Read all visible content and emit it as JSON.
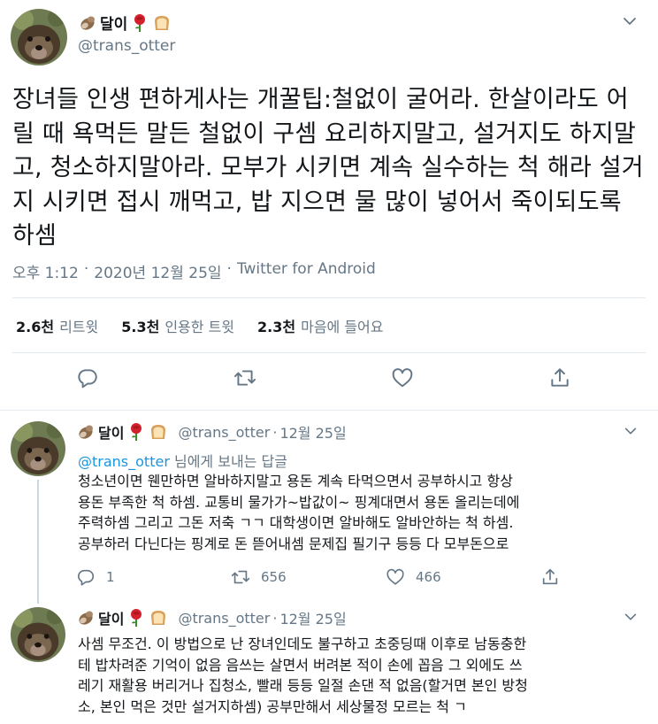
{
  "colors": {
    "accent": "#1b95e0",
    "muted": "#657786",
    "text": "#14171a",
    "icon": "#1b95e0"
  },
  "tweet": {
    "display_name": "달이",
    "handle": "@trans_otter",
    "text": "장녀들 인생 편하게사는 개꿀팁:철없이 굴어라. 한살이라도 어릴 때 욕먹든 말든 철없이 구셈 요리하지말고, 설거지도 하지말고, 청소하지말아라. 모부가 시키면 계속 실수하는 척 해라 설거지 시키면 접시 깨먹고, 밥 지으면 물 많이 넣어서 죽이되도록 하셈",
    "time": "오후 1:12",
    "date": "2020년 12월 25일",
    "source": "Twitter for Android",
    "dot": "·",
    "stats": [
      {
        "count": "2.6천",
        "label": "리트윗"
      },
      {
        "count": "5.3천",
        "label": "인용한 트윗"
      },
      {
        "count": "2.3천",
        "label": "마음에 들어요"
      }
    ],
    "actions": [
      "reply-icon",
      "retweet-icon",
      "like-icon",
      "share-icon"
    ]
  },
  "replies": [
    {
      "display_name": "달이",
      "handle": "@trans_otter",
      "date": "12월 25일",
      "dot": "·",
      "replying_prefix": "@trans_otter",
      "replying_suffix": " 님에게 보내는 답글",
      "lines": [
        "청소년이면 웬만하면 알바하지말고 용돈 계속 타먹으면서 공부하시고 항상",
        "용돈 부족한 척 하셈. 교통비 물가가~밥값이~ 핑계대면서 용돈 올리는데에",
        "주력하셈 그리고 그돈 저축 ㄱㄱ 대학생이면 알바해도 알바안하는 척 하셈.",
        "공부하러 다닌다는 핑계로 돈 뜯어내셈 문제집 필기구 등등 다 모부돈으로"
      ],
      "reply_count": "1",
      "retweet_count": "656",
      "like_count": "466"
    },
    {
      "display_name": "달이",
      "handle": "@trans_otter",
      "date": "12월 25일",
      "dot": "·",
      "lines": [
        "사셈 무조건. 이 방법으로 난 장녀인데도 불구하고 초중딩때 이후로 남동충한",
        "테 밥차려준 기억이 없음 음쓰는 살면서 버려본 적이 손에 꼽음 그 외에도 쓰",
        "레기 재활용 버리거나 집청소, 빨래 등등 일절 손댄 적 없음(할거면 본인 방청",
        "소, 본인 먹은 것만 설거지하셈) 공부만해서 세상물정 모르는 척 ㄱ"
      ]
    }
  ]
}
